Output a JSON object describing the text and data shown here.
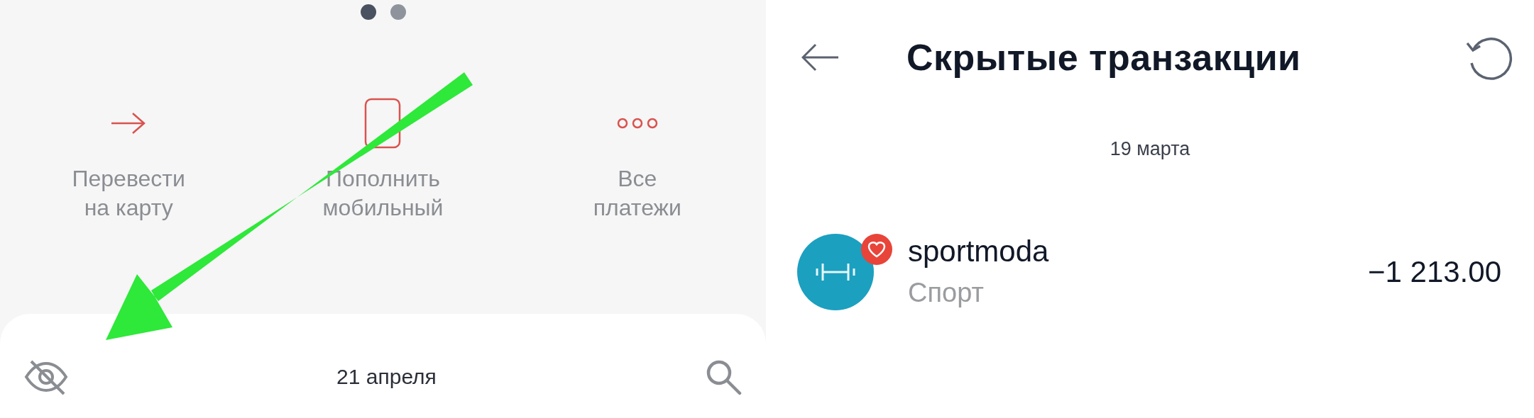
{
  "left_screen": {
    "pager_dots": [
      {
        "selected": true
      },
      {
        "selected": false
      }
    ],
    "actions": [
      {
        "kind": "transfer",
        "label": "Перевести\nна карту"
      },
      {
        "kind": "mobile",
        "label": "Пополнить\nмобильный"
      },
      {
        "kind": "more",
        "label": "Все\nплатежи"
      }
    ],
    "bottom_sheet": {
      "date": "21 апреля"
    }
  },
  "right_screen": {
    "title": "Скрытые транзакции",
    "date": "19 марта",
    "transactions": [
      {
        "name": "sportmoda",
        "category": "Спорт",
        "amount": "−1 213.00",
        "favorite": true
      }
    ]
  }
}
